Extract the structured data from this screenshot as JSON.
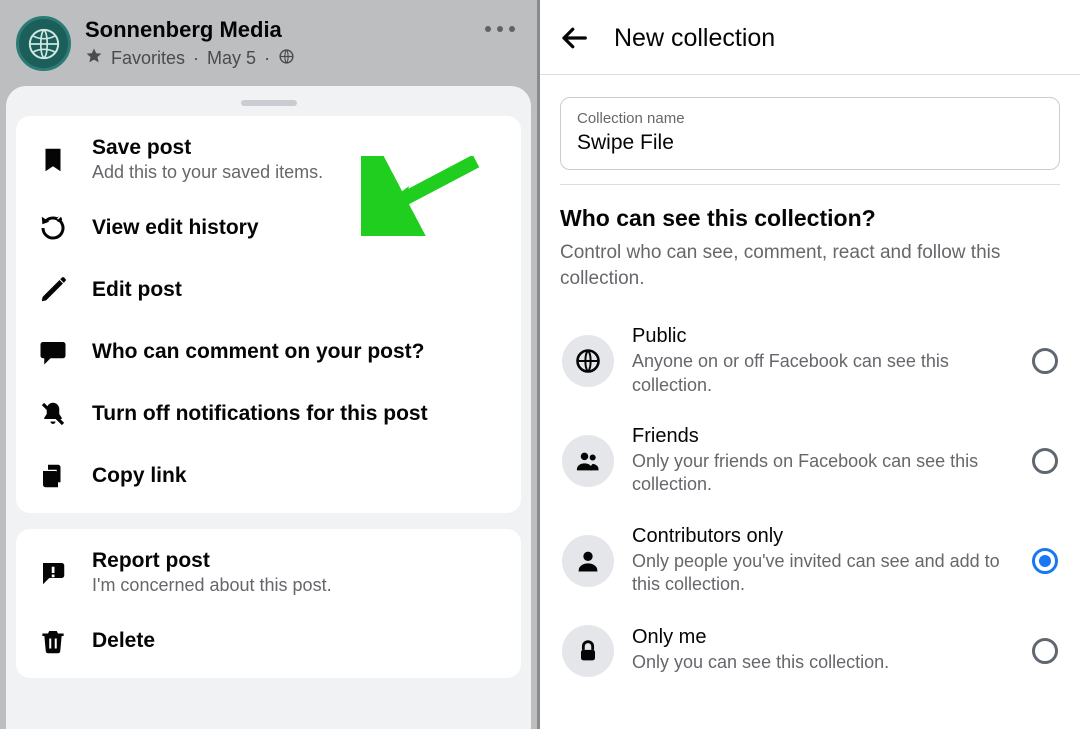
{
  "post": {
    "page_name": "Sonnenberg Media",
    "favorites_label": "Favorites",
    "date": "May 5"
  },
  "menu": {
    "save": {
      "title": "Save post",
      "sub": "Add this to your saved items."
    },
    "history": {
      "title": "View edit history"
    },
    "edit": {
      "title": "Edit post"
    },
    "comment_audience": {
      "title": "Who can comment on your post?"
    },
    "notifications": {
      "title": "Turn off notifications for this post"
    },
    "copy": {
      "title": "Copy link"
    },
    "report": {
      "title": "Report post",
      "sub": "I'm concerned about this post."
    },
    "delete": {
      "title": "Delete"
    }
  },
  "new_collection": {
    "header": "New collection",
    "field_label": "Collection name",
    "field_value": "Swipe File",
    "visibility_heading": "Who can see this collection?",
    "visibility_desc": "Control who can see, comment, react and follow this collection.",
    "options": {
      "public": {
        "title": "Public",
        "sub": "Anyone on or off Facebook can see this collection."
      },
      "friends": {
        "title": "Friends",
        "sub": "Only your friends on Facebook can see this collection."
      },
      "contributors": {
        "title": "Contributors only",
        "sub": "Only people you've invited can see and add to this collection."
      },
      "only_me": {
        "title": "Only me",
        "sub": "Only you can see this collection."
      }
    },
    "selected": "contributors"
  }
}
